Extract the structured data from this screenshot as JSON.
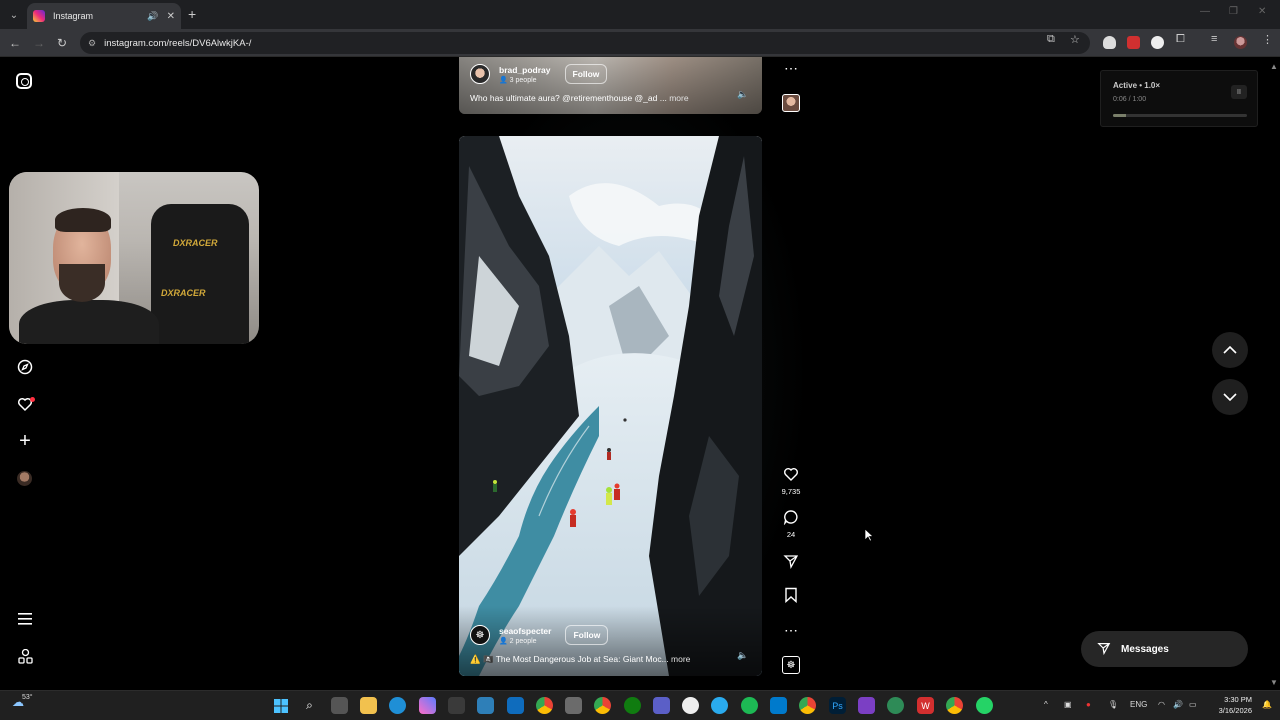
{
  "browser": {
    "tab_title": "Instagram",
    "url": "instagram.com/reels/DV6AlwkjKA-/",
    "new_tab_glyph": "+",
    "tab_close_glyph": "✕"
  },
  "sidebar": {
    "items": [
      {
        "name": "instagram-logo-icon"
      },
      {
        "name": "explore-icon"
      },
      {
        "name": "notifications-heart-icon"
      },
      {
        "name": "create-plus-icon"
      },
      {
        "name": "profile-avatar"
      },
      {
        "name": "menu-hamburger-icon"
      },
      {
        "name": "also-from-meta-icon"
      }
    ]
  },
  "reels": {
    "previous": {
      "username": "brad_podray",
      "people": "3 people",
      "follow_label": "Follow",
      "caption": "Who has ultimate aura? @retirementhouse @_ad ...",
      "more": "more"
    },
    "current": {
      "username": "seaofspecter",
      "people": "2 people",
      "follow_label": "Follow",
      "caption": "⚠️ 🏴‍☠️ The Most Dangerous Job at Sea: Giant Moc...",
      "more": "more",
      "likes": "9,735",
      "comments": "24"
    }
  },
  "player_widget": {
    "status": "Active • 1.0×",
    "time": "0:06 / 1:00",
    "progress": 0.1,
    "pause_glyph": "II"
  },
  "messages": {
    "label": "Messages"
  },
  "taskbar": {
    "temperature": "53°",
    "language": "ENG",
    "time": "3:30 PM",
    "date": "3/16/2026"
  },
  "colors": {
    "background": "#000000",
    "notification_dot": "#ff3040",
    "chair_logo": "#d2a93a",
    "taskbar": "#202020"
  },
  "webcam_overlay": {
    "chair_brand_1": "DXRACER",
    "chair_brand_2": "DXRACER"
  }
}
